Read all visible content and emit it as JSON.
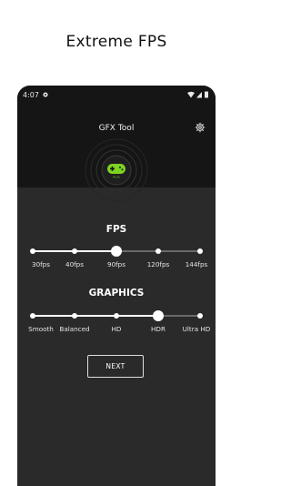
{
  "promo": {
    "title": "Extreme FPS"
  },
  "status_bar": {
    "time": "4:07"
  },
  "app": {
    "title": "GFX Tool",
    "logo_badge": "PLUS"
  },
  "fps": {
    "title": "FPS",
    "options": [
      "30fps",
      "40fps",
      "90fps",
      "120fps",
      "144fps"
    ],
    "selected": "90fps"
  },
  "graphics": {
    "title": "GRAPHICS",
    "options": [
      "Smooth",
      "Balanced",
      "HD",
      "HDR",
      "Ultra HD"
    ],
    "selected": "HDR"
  },
  "next_button": {
    "label": "NEXT"
  },
  "colors": {
    "accent_green": "#7ed321",
    "screen_bg": "#2a2a2a",
    "header_bg": "#151515"
  }
}
